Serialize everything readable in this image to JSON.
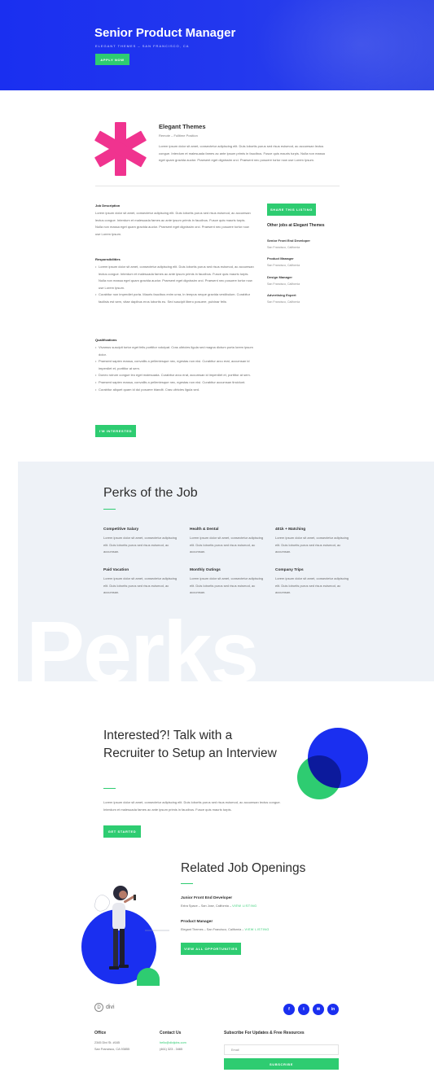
{
  "colors": {
    "brand_blue": "#1a2ff0",
    "accent_green": "#2ecc71",
    "accent_pink": "#f0338f",
    "perks_bg": "#eef2f7"
  },
  "hero": {
    "title": "Senior Product Manager",
    "subtitle": "Elegant Themes – San Francisco, CA",
    "apply_label": "Apply Now"
  },
  "company": {
    "logo_icon": "asterisk-icon",
    "name": "Elegant Themes",
    "meta": "Remote – Fulltime Position",
    "description": "Lorem ipsum dolor sit amet, consectetur adipiscing elit. Duis lobortis purus sed risus euismod, ac accumsan lectus congue. Interdum et malesuada fames ac ante ipsum primis in faucibus. Fusce quis mauris turpis. Nulla non massa eget quam gravida auctor. Praesent eget dignissim orci. Praesent nec posuere tortor now use Lorem Ipsum."
  },
  "job": {
    "description_heading": "Job Description",
    "description_text": "Lorem ipsum dolor sit amet, consectetur adipiscing elit. Duis lobortis purus sed risus euismod, ac accumsan lectus congue. Interdum et malesuada fames ac ante ipsum primis in faucibus. Fusce quis mauris turpis. Nulla non massa eget quam gravida auctor. Praesent eget dignissim orci. Praesent nec posuere tortor now use Lorem Ipsum.",
    "responsibilities_heading": "Responsibilities",
    "responsibilities": [
      "Lorem ipsum dolor sit amet, consectetur adipiscing elit. Duis lobortis purus sed risus euismod, ac accumsan lectus congue. Interdum et malesuada fames ac ante ipsum primis in faucibus. Fusce quis mauris turpis. Nulla non massa eget quam gravida auctor. Praesent eget dignissim orci. Praesent nec posuere tortor now use Lorem Ipsum.",
      "Curabitur non imperdiet porta. Mauris faucibus enim urna, in tempus neque gravida vestibulum. Curabitur facilisis est sem, vitae dapibus eros lobortis eu. Sed suscipit libero posuere, pulvinar felis"
    ],
    "qualifications_heading": "Qualifications",
    "qualifications": [
      "Vivamus suscipit tortor eget felis porttitor volutpat. Cras ultricies ligula sed magna dictum porta lorem ipsum dolor.",
      "Praesent sapien massa, convallis a pellentesque nec, egestas non nisi. Curabitur arcu erat, accumsan id imperdiet et, porttitor at sem.",
      "Donec rutrum congue leo eget malesuada. Curabitur arcu erat, accumsan id imperdiet et, porttitor at sem.",
      "Praesent sapien massa, convallis a pellentesque nec, egestas non nisi. Curabitur accumsan tincidunt.",
      "Curabitur aliquet quam id dui posuere blandit. Cras ultricies ligula sed."
    ],
    "interested_label": "I'm Interested"
  },
  "sidebar": {
    "share_label": "Share This Listing",
    "other_jobs_heading": "Other jobs at Elegant Themes",
    "jobs": [
      {
        "title": "Senior Front End Developer",
        "location": "San Francisco, California"
      },
      {
        "title": "Product Manager",
        "location": "San Francisco, California"
      },
      {
        "title": "Design Manager",
        "location": "San Francisco, California"
      },
      {
        "title": "Advertising Expert",
        "location": "San Francisco, California"
      }
    ]
  },
  "perks": {
    "heading": "Perks of the Job",
    "background_word": "Perks",
    "items": [
      {
        "title": "Competitive Salary",
        "text": "Lorem ipsum dolor sit amet, consectetur adipiscing elit. Duis lobortis purus sed risus euismod, ac accumsan."
      },
      {
        "title": "Health & Dental",
        "text": "Lorem ipsum dolor sit amet, consectetur adipiscing elit. Duis lobortis purus sed risus euismod, ac accumsan."
      },
      {
        "title": "401k + Matching",
        "text": "Lorem ipsum dolor sit amet, consectetur adipiscing elit. Duis lobortis purus sed risus euismod, ac accumsan."
      },
      {
        "title": "Paid Vacation",
        "text": "Lorem ipsum dolor sit amet, consectetur adipiscing elit. Duis lobortis purus sed risus euismod, ac accumsan."
      },
      {
        "title": "Monthly Outings",
        "text": "Lorem ipsum dolor sit amet, consectetur adipiscing elit. Duis lobortis purus sed risus euismod, ac accumsan."
      },
      {
        "title": "Company Trips",
        "text": "Lorem ipsum dolor sit amet, consectetur adipiscing elit. Duis lobortis purus sed risus euismod, ac accumsan."
      }
    ]
  },
  "interested": {
    "heading": "Interested?! Talk with a Recruiter to Setup an Interview",
    "text": "Lorem ipsum dolor sit amet, consectetur adipiscing elit. Duis lobortis purus sed risus euismod, ac accumsan lectus congue. Interdum et malesuada fames ac ante ipsum primis in faucibus. Fusce quis mauris turpis.",
    "button_label": "Get Started"
  },
  "related": {
    "heading": "Related Job Openings",
    "jobs": [
      {
        "title": "Junior Front End Developer",
        "meta": "Extra Space – San Jose, California – ",
        "link": "View Listing"
      },
      {
        "title": "Product Manager",
        "meta": "Elegant Themes – San Francisco, California – ",
        "link": "View Listing"
      }
    ],
    "button_label": "View All Opportunities"
  },
  "footer": {
    "logo_text": "divi",
    "logo_letter": "D",
    "social": [
      {
        "icon": "facebook-icon",
        "glyph": "f"
      },
      {
        "icon": "twitter-icon",
        "glyph": "t"
      },
      {
        "icon": "email-icon",
        "glyph": "✉"
      },
      {
        "icon": "linkedin-icon",
        "glyph": "in"
      }
    ],
    "office_heading": "Office",
    "office_line1": "2345 Divi St. #165",
    "office_line2": "San Francisco, CA 93855",
    "contact_heading": "Contact Us",
    "contact_email": "hello@divijobs.com",
    "contact_phone": "(461) 323 - 3465",
    "subscribe_heading": "Subscribe For Updates & Free Resources",
    "email_placeholder": "Email",
    "subscribe_label": "Subscribe"
  }
}
